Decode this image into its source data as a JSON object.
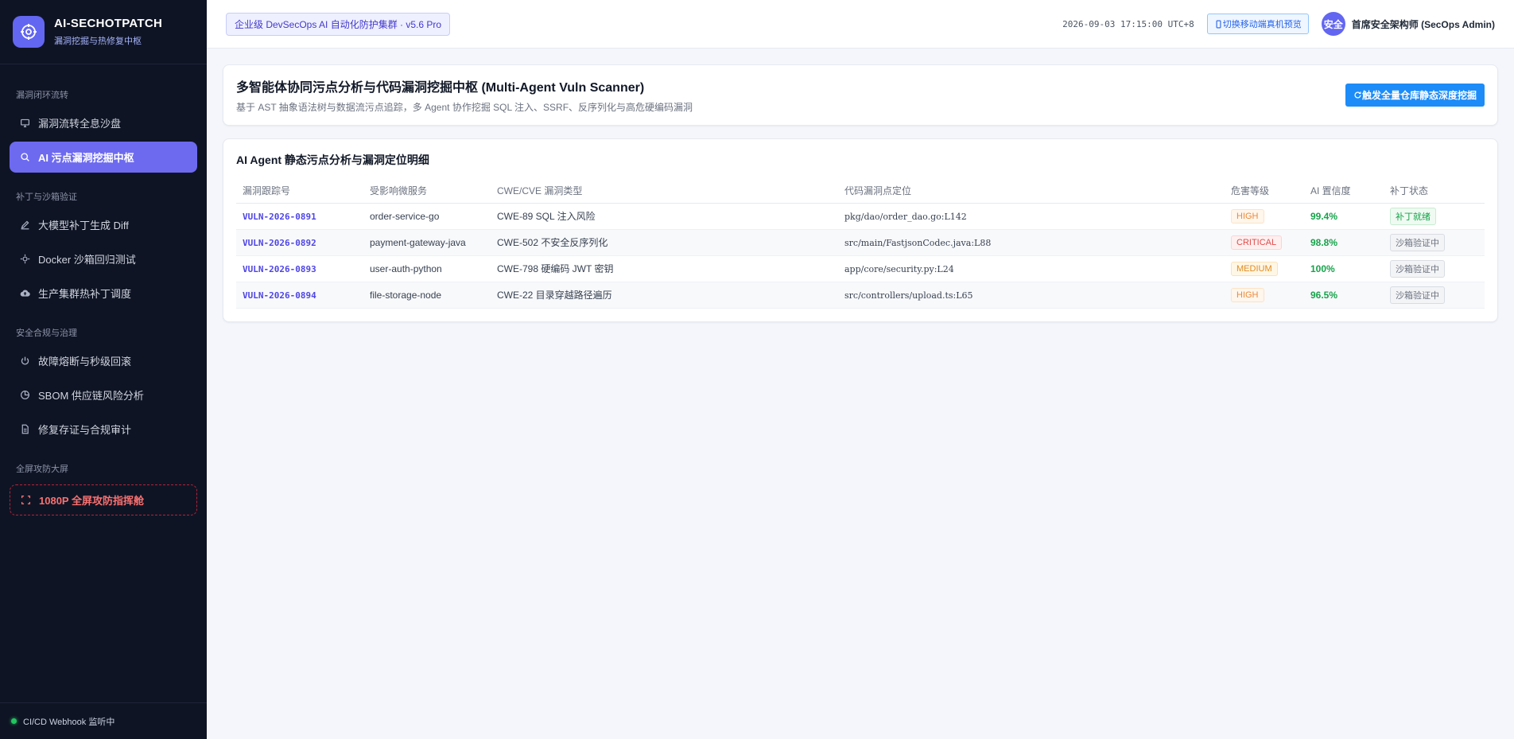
{
  "brand": {
    "title": "AI-SECHOTPATCH",
    "subtitle": "漏洞挖掘与热修复中枢"
  },
  "sidebar": {
    "sections": [
      {
        "label": "漏洞闭环流转",
        "items": [
          {
            "label": "漏洞流转全息沙盘",
            "icon": "monitor-icon"
          },
          {
            "label": "AI 污点漏洞挖掘中枢",
            "icon": "search-icon",
            "active": true
          }
        ]
      },
      {
        "label": "补丁与沙箱验证",
        "items": [
          {
            "label": "大模型补丁生成 Diff",
            "icon": "pen-icon"
          },
          {
            "label": "Docker 沙箱回归测试",
            "icon": "chip-icon"
          },
          {
            "label": "生产集群热补丁调度",
            "icon": "cloud-upload-icon"
          }
        ]
      },
      {
        "label": "安全合规与治理",
        "items": [
          {
            "label": "故障熔断与秒级回滚",
            "icon": "power-icon"
          },
          {
            "label": "SBOM 供应链风险分析",
            "icon": "pie-chart-icon"
          },
          {
            "label": "修复存证与合规审计",
            "icon": "document-icon"
          }
        ]
      },
      {
        "label": "全屏攻防大屏",
        "items": [
          {
            "label": "1080P 全屏攻防指挥舱",
            "icon": "fullscreen-icon",
            "danger": true
          }
        ]
      }
    ],
    "footer": "CI/CD Webhook 监听中"
  },
  "topbar": {
    "env_badge": "企业级 DevSecOps AI 自动化防护集群 · v5.6 Pro",
    "datetime": "2026-09-03 17:15:00 UTC+8",
    "mobile_button": "切换移动端真机预览",
    "avatar_text": "安全",
    "user_name": "首席安全架构师 (SecOps Admin)"
  },
  "hero": {
    "title": "多智能体协同污点分析与代码漏洞挖掘中枢 (Multi-Agent Vuln Scanner)",
    "subtitle": "基于 AST 抽象语法树与数据流污点追踪，多 Agent 协作挖掘 SQL 注入、SSRF、反序列化与高危硬编码漏洞",
    "action_button": "触发全量仓库静态深度挖掘"
  },
  "table": {
    "title": "AI Agent 静态污点分析与漏洞定位明细",
    "headers": [
      "漏洞跟踪号",
      "受影响微服务",
      "CWE/CVE 漏洞类型",
      "代码漏洞点定位",
      "危害等级",
      "AI 置信度",
      "补丁状态"
    ],
    "rows": [
      {
        "id": "VULN-2026-0891",
        "service": "order-service-go",
        "type": "CWE-89 SQL 注入风险",
        "location": "pkg/dao/order_dao.go:L142",
        "severity": "HIGH",
        "confidence": "99.4%",
        "status": "补丁就绪"
      },
      {
        "id": "VULN-2026-0892",
        "service": "payment-gateway-java",
        "type": "CWE-502 不安全反序列化",
        "location": "src/main/FastjsonCodec.java:L88",
        "severity": "CRITICAL",
        "confidence": "98.8%",
        "status": "沙箱验证中"
      },
      {
        "id": "VULN-2026-0893",
        "service": "user-auth-python",
        "type": "CWE-798 硬编码 JWT 密钥",
        "location": "app/core/security.py:L24",
        "severity": "MEDIUM",
        "confidence": "100%",
        "status": "沙箱验证中"
      },
      {
        "id": "VULN-2026-0894",
        "service": "file-storage-node",
        "type": "CWE-22 目录穿越路径遍历",
        "location": "src/controllers/upload.ts:L65",
        "severity": "HIGH",
        "confidence": "96.5%",
        "status": "沙箱验证中"
      }
    ]
  },
  "colors": {
    "sidebar_bg": "#0f1424",
    "accent": "#6d6af0",
    "primary_button": "#1d8cf8",
    "danger": "#f87171",
    "success": "#16a34a"
  }
}
